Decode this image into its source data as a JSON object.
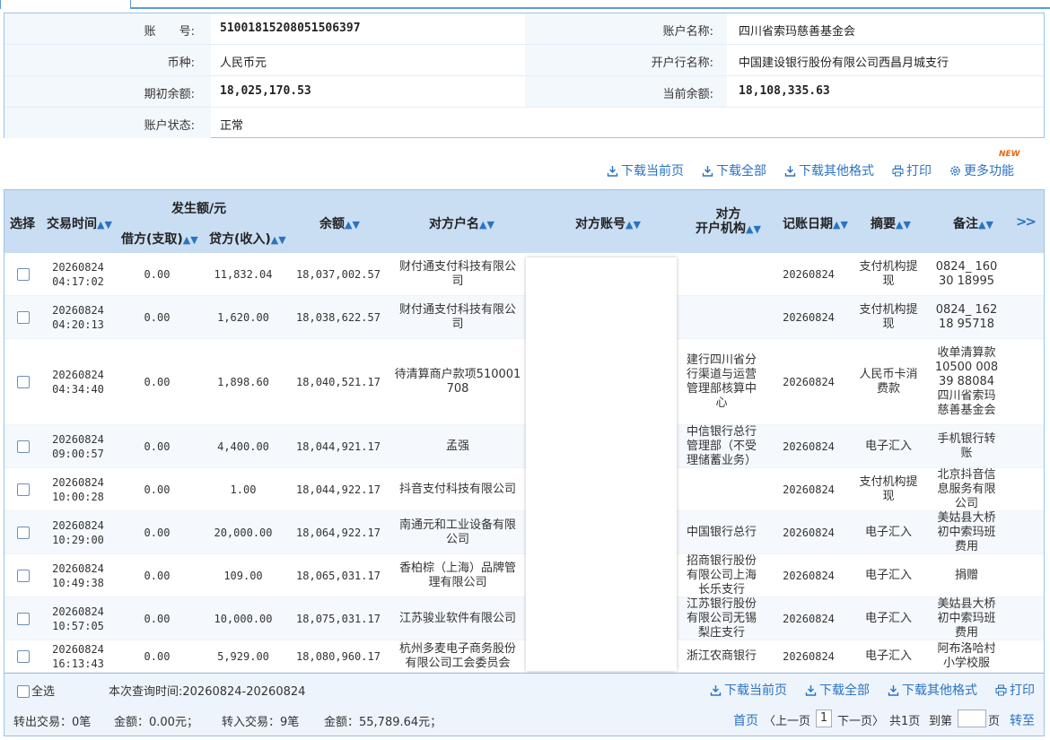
{
  "account": {
    "account_no_label": "账　　号:",
    "account_no": "51001815208051506397",
    "account_name_label": "账户名称:",
    "account_name": "四川省索玛慈善基金会",
    "currency_label": "币种:",
    "currency": "人民币元",
    "bank_label": "开户行名称:",
    "bank": "中国建设银行股份有限公司西昌月城支行",
    "opening_balance_label": "期初余额:",
    "opening_balance": "18,025,170.53",
    "current_balance_label": "当前余额:",
    "current_balance": "18,108,335.63",
    "status_label": "账户状态:",
    "status": "正常"
  },
  "toolbar": {
    "download_page": "下载当前页",
    "download_all": "下载全部",
    "download_other": "下载其他格式",
    "print": "打印",
    "more": "更多功能",
    "new_badge": "NEW"
  },
  "table": {
    "headers": {
      "select": "选择",
      "time": "交易时间",
      "amount_group": "发生额/元",
      "debit": "借方(支取)",
      "credit": "贷方(收入)",
      "balance": "余额",
      "counterparty_name": "对方户名",
      "counterparty_account": "对方账号",
      "counterparty_bank_1": "对方",
      "counterparty_bank_2": "开户机构",
      "post_date": "记账日期",
      "summary": "摘要",
      "remark": "备注",
      "more": ">>"
    },
    "rows": [
      {
        "time1": "20260824",
        "time2": "04:17:02",
        "debit": "0.00",
        "credit": "11,832.04",
        "balance": "18,037,002.57",
        "name": "财付通支付科技有限公司",
        "bank": "",
        "date": "20260824",
        "summary": "支付机构提现",
        "remark": "0824_ 16030 18995"
      },
      {
        "time1": "20260824",
        "time2": "04:20:13",
        "debit": "0.00",
        "credit": "1,620.00",
        "balance": "18,038,622.57",
        "name": "财付通支付科技有限公司",
        "bank": "",
        "date": "20260824",
        "summary": "支付机构提现",
        "remark": "0824_ 16218 95718"
      },
      {
        "time1": "20260824",
        "time2": "04:34:40",
        "debit": "0.00",
        "credit": "1,898.60",
        "balance": "18,040,521.17",
        "name": "待清算商户款项510001708",
        "bank": "建行四川省分行渠道与运营管理部核算中心",
        "date": "20260824",
        "summary": "人民币卡消费款",
        "remark": "收单清算款 10500 00839 88084 四川省索玛慈善基金会"
      },
      {
        "time1": "20260824",
        "time2": "09:00:57",
        "debit": "0.00",
        "credit": "4,400.00",
        "balance": "18,044,921.17",
        "name": "孟强",
        "bank": "中信银行总行管理部（不受理储蓄业务）",
        "date": "20260824",
        "summary": "电子汇入",
        "remark": "手机银行转账"
      },
      {
        "time1": "20260824",
        "time2": "10:00:28",
        "debit": "0.00",
        "credit": "1.00",
        "balance": "18,044,922.17",
        "name": "抖音支付科技有限公司",
        "bank": "",
        "date": "20260824",
        "summary": "支付机构提现",
        "remark": "北京抖音信息服务有限公司"
      },
      {
        "time1": "20260824",
        "time2": "10:29:00",
        "debit": "0.00",
        "credit": "20,000.00",
        "balance": "18,064,922.17",
        "name": "南通元和工业设备有限公司",
        "bank": "中国银行总行",
        "date": "20260824",
        "summary": "电子汇入",
        "remark": "美姑县大桥初中索玛班费用"
      },
      {
        "time1": "20260824",
        "time2": "10:49:38",
        "debit": "0.00",
        "credit": "109.00",
        "balance": "18,065,031.17",
        "name": "香柏棕（上海）品牌管理有限公司",
        "bank": "招商银行股份有限公司上海长乐支行",
        "date": "20260824",
        "summary": "电子汇入",
        "remark": "捐赠"
      },
      {
        "time1": "20260824",
        "time2": "10:57:05",
        "debit": "0.00",
        "credit": "10,000.00",
        "balance": "18,075,031.17",
        "name": "江苏骏业软件有限公司",
        "bank": "江苏银行股份有限公司无锡梨庄支行",
        "date": "20260824",
        "summary": "电子汇入",
        "remark": "美姑县大桥初中索玛班费用"
      },
      {
        "time1": "20260824",
        "time2": "16:13:43",
        "debit": "0.00",
        "credit": "5,929.00",
        "balance": "18,080,960.17",
        "name": "杭州多麦电子商务股份有限公司工会委员会",
        "bank": "浙江农商银行",
        "date": "20260824",
        "summary": "电子汇入",
        "remark": "阿布洛哈村小学校服"
      }
    ]
  },
  "footer": {
    "select_all": "全选",
    "query_time": "本次查询时间:20260824-20260824",
    "download_page": "下载当前页",
    "download_all": "下载全部",
    "download_other": "下载其他格式",
    "print": "打印",
    "out_count": "转出交易：0笔",
    "out_amount": "金额：0.00元；",
    "in_count": "转入交易：9笔",
    "in_amount": "金额：55,789.64元；",
    "first": "首页",
    "prev": "〈上一页",
    "page": "1",
    "next": "下一页〉",
    "total": "共1页",
    "goto": "到第",
    "page_unit": "页",
    "go": "转至"
  },
  "colors": {
    "accent": "#2a73c2",
    "header_bg": "#c9def3",
    "border": "#9cc2e6",
    "new": "#e8670c"
  }
}
